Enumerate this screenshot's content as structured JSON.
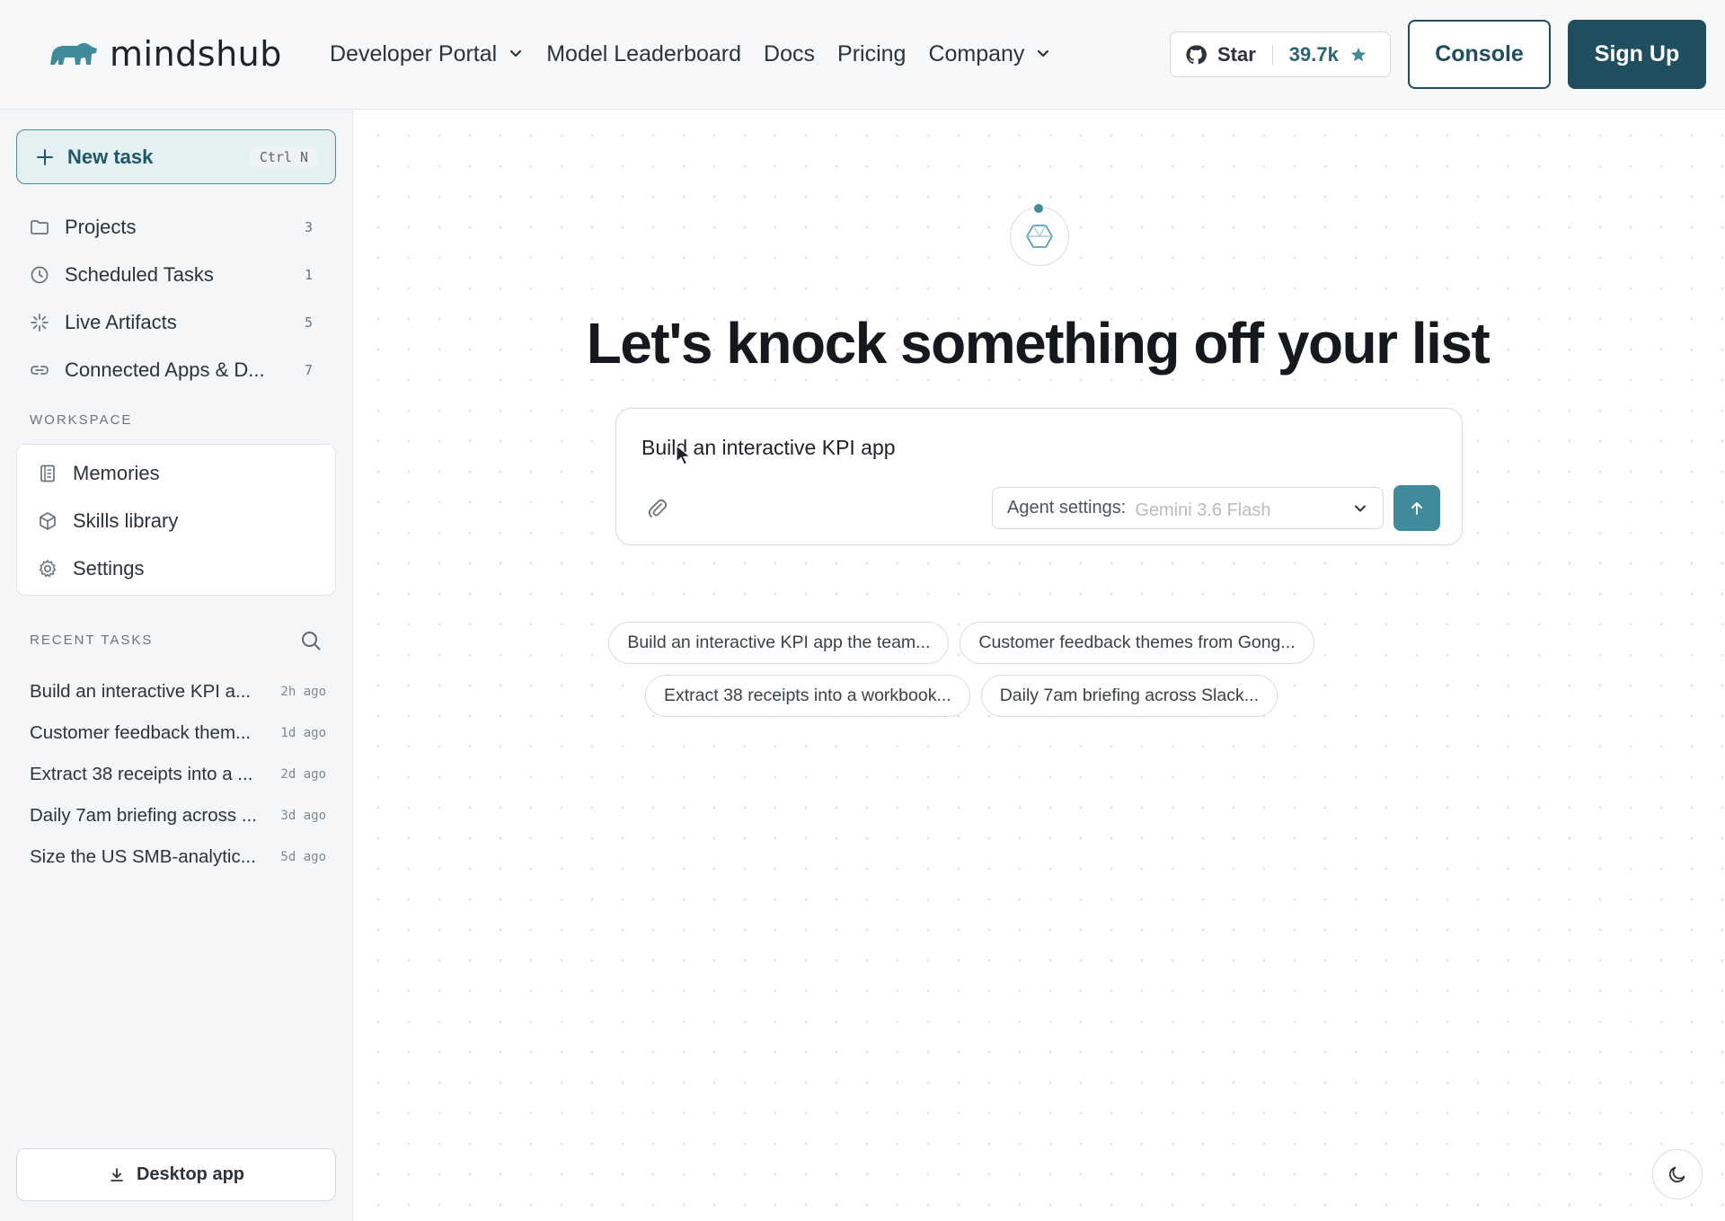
{
  "brand": {
    "name": "mindshub",
    "logo_icon": "bear-icon",
    "accent": "#3f8a9b",
    "primary_dark": "#1f4e5f"
  },
  "nav": {
    "items": [
      {
        "label": "Developer Portal",
        "dropdown": true
      },
      {
        "label": "Model Leaderboard",
        "dropdown": false
      },
      {
        "label": "Docs",
        "dropdown": false
      },
      {
        "label": "Pricing",
        "dropdown": false
      },
      {
        "label": "Company",
        "dropdown": true
      }
    ],
    "github": {
      "label": "Star",
      "count": "39.7k"
    },
    "console_label": "Console",
    "signup_label": "Sign Up"
  },
  "sidebar": {
    "new_task": {
      "label": "New task",
      "shortcut": "Ctrl N"
    },
    "items": [
      {
        "label": "Projects",
        "count": "3",
        "icon": "folder-icon"
      },
      {
        "label": "Scheduled Tasks",
        "count": "1",
        "icon": "clock-icon"
      },
      {
        "label": "Live Artifacts",
        "count": "5",
        "icon": "sparkle-icon"
      },
      {
        "label": "Connected Apps & D...",
        "count": "7",
        "icon": "link-icon"
      }
    ],
    "workspace_label": "WORKSPACE",
    "workspace": [
      {
        "label": "Memories",
        "icon": "notebook-icon"
      },
      {
        "label": "Skills library",
        "icon": "cube-icon"
      },
      {
        "label": "Settings",
        "icon": "gear-icon"
      }
    ],
    "recent_label": "RECENT TASKS",
    "recent": [
      {
        "title": "Build an interactive KPI a...",
        "ago": "2h ago"
      },
      {
        "title": "Customer feedback them...",
        "ago": "1d ago"
      },
      {
        "title": "Extract 38 receipts into a ...",
        "ago": "2d ago"
      },
      {
        "title": "Daily 7am briefing across ...",
        "ago": "3d ago"
      },
      {
        "title": "Size the US SMB-analytic...",
        "ago": "5d ago"
      }
    ],
    "desktop_app_label": "Desktop app"
  },
  "main": {
    "headline": "Let's knock something off your list",
    "composer": {
      "prompt_value": "Build an interactive KPI app",
      "agent_label": "Agent settings:",
      "agent_value": "Gemini 3.6 Flash"
    },
    "suggestions": [
      "Build an interactive KPI app the team...",
      "Customer feedback themes from Gong...",
      "Extract 38 receipts into a workbook...",
      "Daily 7am briefing across Slack..."
    ]
  }
}
